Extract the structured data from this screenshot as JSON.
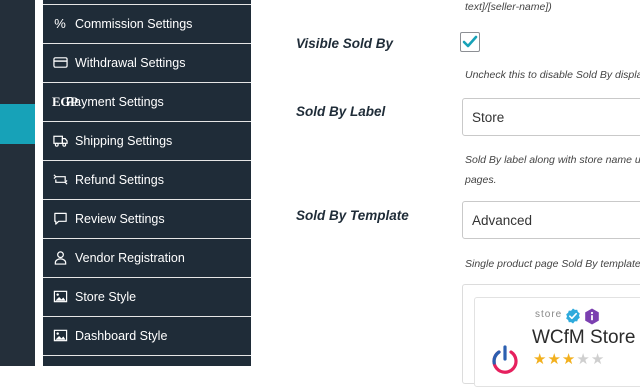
{
  "sidebar": {
    "items": [
      {
        "label": "Commission Settings",
        "icon": "percent-icon",
        "icon_text": "%"
      },
      {
        "label": "Withdrawal Settings",
        "icon": "credit-card-icon"
      },
      {
        "label": "Payment Settings",
        "icon": "egp-currency-icon",
        "icon_text": "EGP"
      },
      {
        "label": "Shipping Settings",
        "icon": "truck-icon"
      },
      {
        "label": "Refund Settings",
        "icon": "refund-icon"
      },
      {
        "label": "Review Settings",
        "icon": "comment-icon"
      },
      {
        "label": "Vendor Registration",
        "icon": "user-icon"
      },
      {
        "label": "Store Style",
        "icon": "image-icon"
      },
      {
        "label": "Dashboard Style",
        "icon": "image-icon"
      }
    ]
  },
  "content": {
    "top_snippet": "text]/[seller-name])",
    "visible_sold_by": {
      "label": "Visible Sold By",
      "checked": true,
      "help": "Uncheck this to disable Sold By displa"
    },
    "sold_by_label": {
      "label": "Sold By Label",
      "value": "Store",
      "help_line1": "Sold By label along with store name u",
      "help_line2": "pages."
    },
    "sold_by_template": {
      "label": "Sold By Template",
      "value": "Advanced",
      "help": "Single product page Sold By template"
    },
    "preview": {
      "store_tag": "store",
      "store_name": "WCfM Store",
      "rating": 3,
      "rating_max": 5
    }
  },
  "colors": {
    "rail": "#242f3a",
    "menu": "#1f2c38",
    "accent": "#17a2b8",
    "star": "#f2b01e",
    "power": "#e6205e"
  }
}
